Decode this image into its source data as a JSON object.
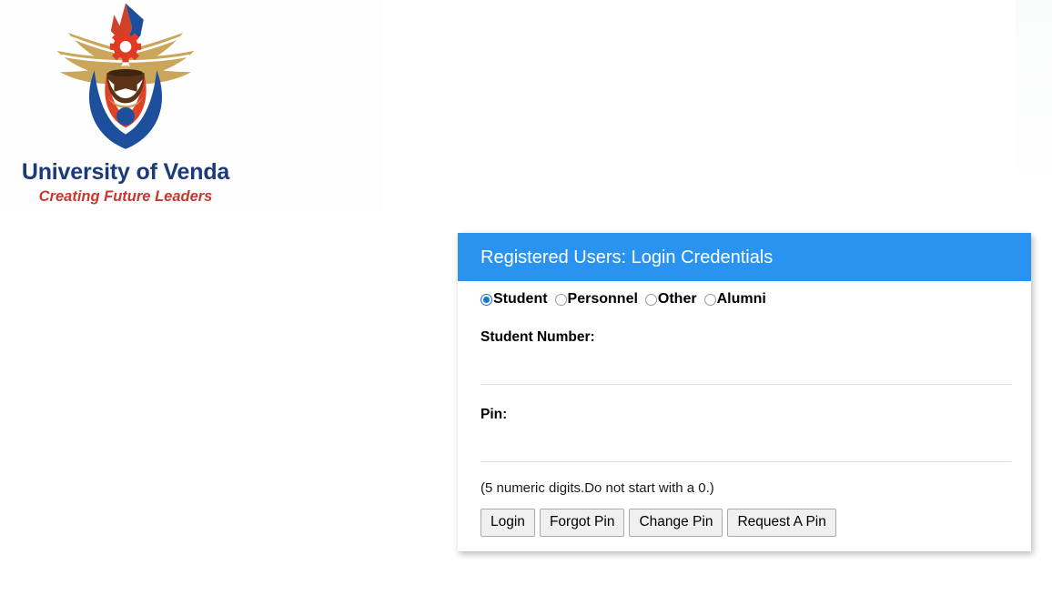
{
  "branding": {
    "crest_icon": "university-crest-icon",
    "name": "University of Venda",
    "tagline": "Creating Future Leaders",
    "name_color": "#1d3a78",
    "tagline_color": "#c8382f"
  },
  "login_card": {
    "header_title": "Registered Users: Login Credentials",
    "header_color": "#2a93ef",
    "user_types": [
      {
        "label": "Student",
        "selected": true
      },
      {
        "label": "Personnel",
        "selected": false
      },
      {
        "label": "Other",
        "selected": false
      },
      {
        "label": "Alumni",
        "selected": false
      }
    ],
    "fields": [
      {
        "label": "Student Number:",
        "value": "",
        "placeholder": ""
      },
      {
        "label": "Pin:",
        "value": "",
        "placeholder": ""
      }
    ],
    "hint": "(5 numeric digits.Do not start with a 0.)",
    "buttons": [
      {
        "label": "Login"
      },
      {
        "label": "Forgot Pin"
      },
      {
        "label": "Change Pin"
      },
      {
        "label": "Request A Pin"
      }
    ]
  }
}
